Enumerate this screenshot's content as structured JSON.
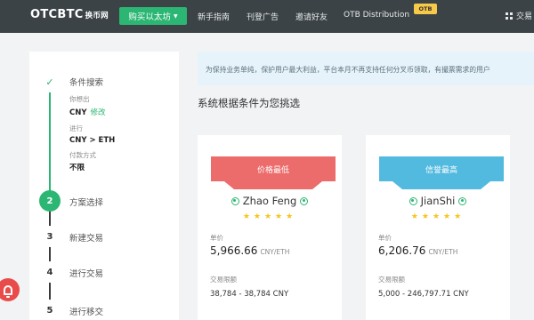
{
  "navbar": {
    "logo": "OTCBTC",
    "logo_sub": "换币网",
    "buy_button": "购买以太坊",
    "links": [
      "新手指南",
      "刊登广告",
      "邀请好友",
      "OTB Distribution"
    ],
    "otb_badge": "OTB",
    "trade_label": "交易"
  },
  "steps": [
    {
      "number": "✓",
      "title": "条件搜索",
      "state": "done"
    },
    {
      "number": "2",
      "title": "方案选择",
      "state": "active"
    },
    {
      "number": "3",
      "title": "新建交易",
      "state": "todo"
    },
    {
      "number": "4",
      "title": "进行交易",
      "state": "todo"
    },
    {
      "number": "5",
      "title": "进行移交",
      "state": "todo"
    }
  ],
  "search_summary": {
    "currency_label": "你想出",
    "currency_value": "CNY",
    "edit_label": "修改",
    "pair_label": "进行",
    "pair_value": "CNY > ETH",
    "payment_label": "付款方式",
    "payment_value": "不限"
  },
  "notice": "为保持业务单纯，保护用户最大利益，平台本月不再支持任何分叉币领取，有撮票需求的用户",
  "section_title": "系统根据条件为您挑选",
  "offers": [
    {
      "ribbon": "价格最低",
      "merchant": "Zhao Feng",
      "rating": 5,
      "stars": "★★★★★",
      "price_label": "单价",
      "price": "5,966.66",
      "unit": "CNY/ETH",
      "limit_label": "交易限额",
      "limit": "38,784 - 38,784 CNY"
    },
    {
      "ribbon": "信誉最高",
      "merchant": "JianShi",
      "rating": 5,
      "stars": "★★★★★",
      "price_label": "单价",
      "price": "6,206.76",
      "unit": "CNY/ETH",
      "limit_label": "交易限额",
      "limit": "5,000 - 246,797.71 CNY"
    }
  ],
  "colors": {
    "navbar": "#3b4346",
    "accent_green": "#2bb673",
    "ribbon_red": "#ec6b6b",
    "ribbon_blue": "#52b9df",
    "notice_bg": "#e6f3fa",
    "bell_red": "#e94b4b",
    "star": "#f5c518"
  }
}
